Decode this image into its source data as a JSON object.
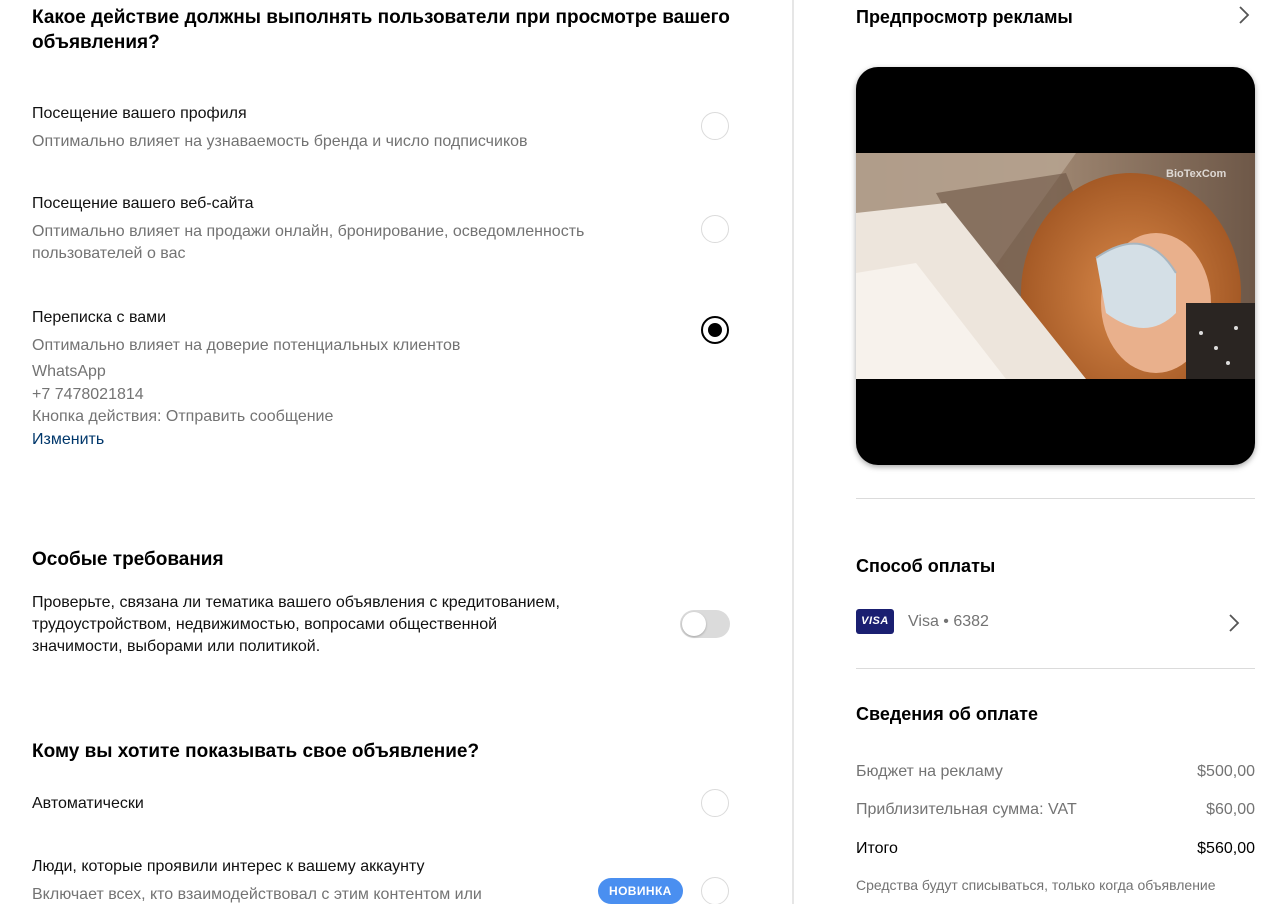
{
  "action_section": {
    "title": "Какое действие должны выполнять пользователи при просмотре вашего объявления?",
    "options": [
      {
        "title": "Посещение вашего профиля",
        "subtitle": "Оптимально влияет на узнаваемость бренда и число подписчиков",
        "selected": false
      },
      {
        "title": "Посещение вашего веб-сайта",
        "subtitle_line1": "Оптимально влияет на продажи онлайн, бронирование, осведомленность",
        "subtitle_line2": "пользователей о вас",
        "selected": false
      },
      {
        "title": "Переписка с вами",
        "subtitle": "Оптимально влияет на доверие потенциальных клиентов",
        "selected": true,
        "app": "WhatsApp",
        "phone": "+7 7478021814",
        "button_text": "Кнопка действия: Отправить сообщение",
        "edit_link": "Изменить"
      }
    ]
  },
  "special_requirements": {
    "title": "Особые требования",
    "description_line1": "Проверьте, связана ли тематика вашего объявления с кредитованием,",
    "description_line2": "трудоустройством, недвижимостью, вопросами общественной",
    "description_line3": "значимости, выборами или политикой.",
    "toggle_on": false
  },
  "audience_section": {
    "title": "Кому вы хотите показывать свое объявление?",
    "options": [
      {
        "title": "Автоматически",
        "selected": false
      },
      {
        "title": "Люди, которые проявили интерес к вашему аккаунту",
        "subtitle": "Включает всех, кто взаимодействовал с этим контентом или",
        "badge": "НОВИНКА",
        "selected": false
      }
    ]
  },
  "preview": {
    "title": "Предпросмотр рекламы",
    "watermark": "BioTexCom"
  },
  "payment_method": {
    "title": "Способ оплаты",
    "card_brand": "VISA",
    "card_label": "Visa • 6382"
  },
  "payment_details": {
    "title": "Сведения об оплате",
    "rows": [
      {
        "label": "Бюджет на рекламу",
        "value": "$500,00"
      },
      {
        "label": "Приблизительная сумма: VAT",
        "value": "$60,00"
      },
      {
        "label": "Итого",
        "value": "$560,00"
      }
    ],
    "note": "Средства будут списываться, только когда объявление"
  },
  "colors": {
    "accent_link": "#00376b",
    "badge_blue": "#4a8ff0",
    "visa_navy": "#1a1f71",
    "muted_text": "#737373"
  }
}
